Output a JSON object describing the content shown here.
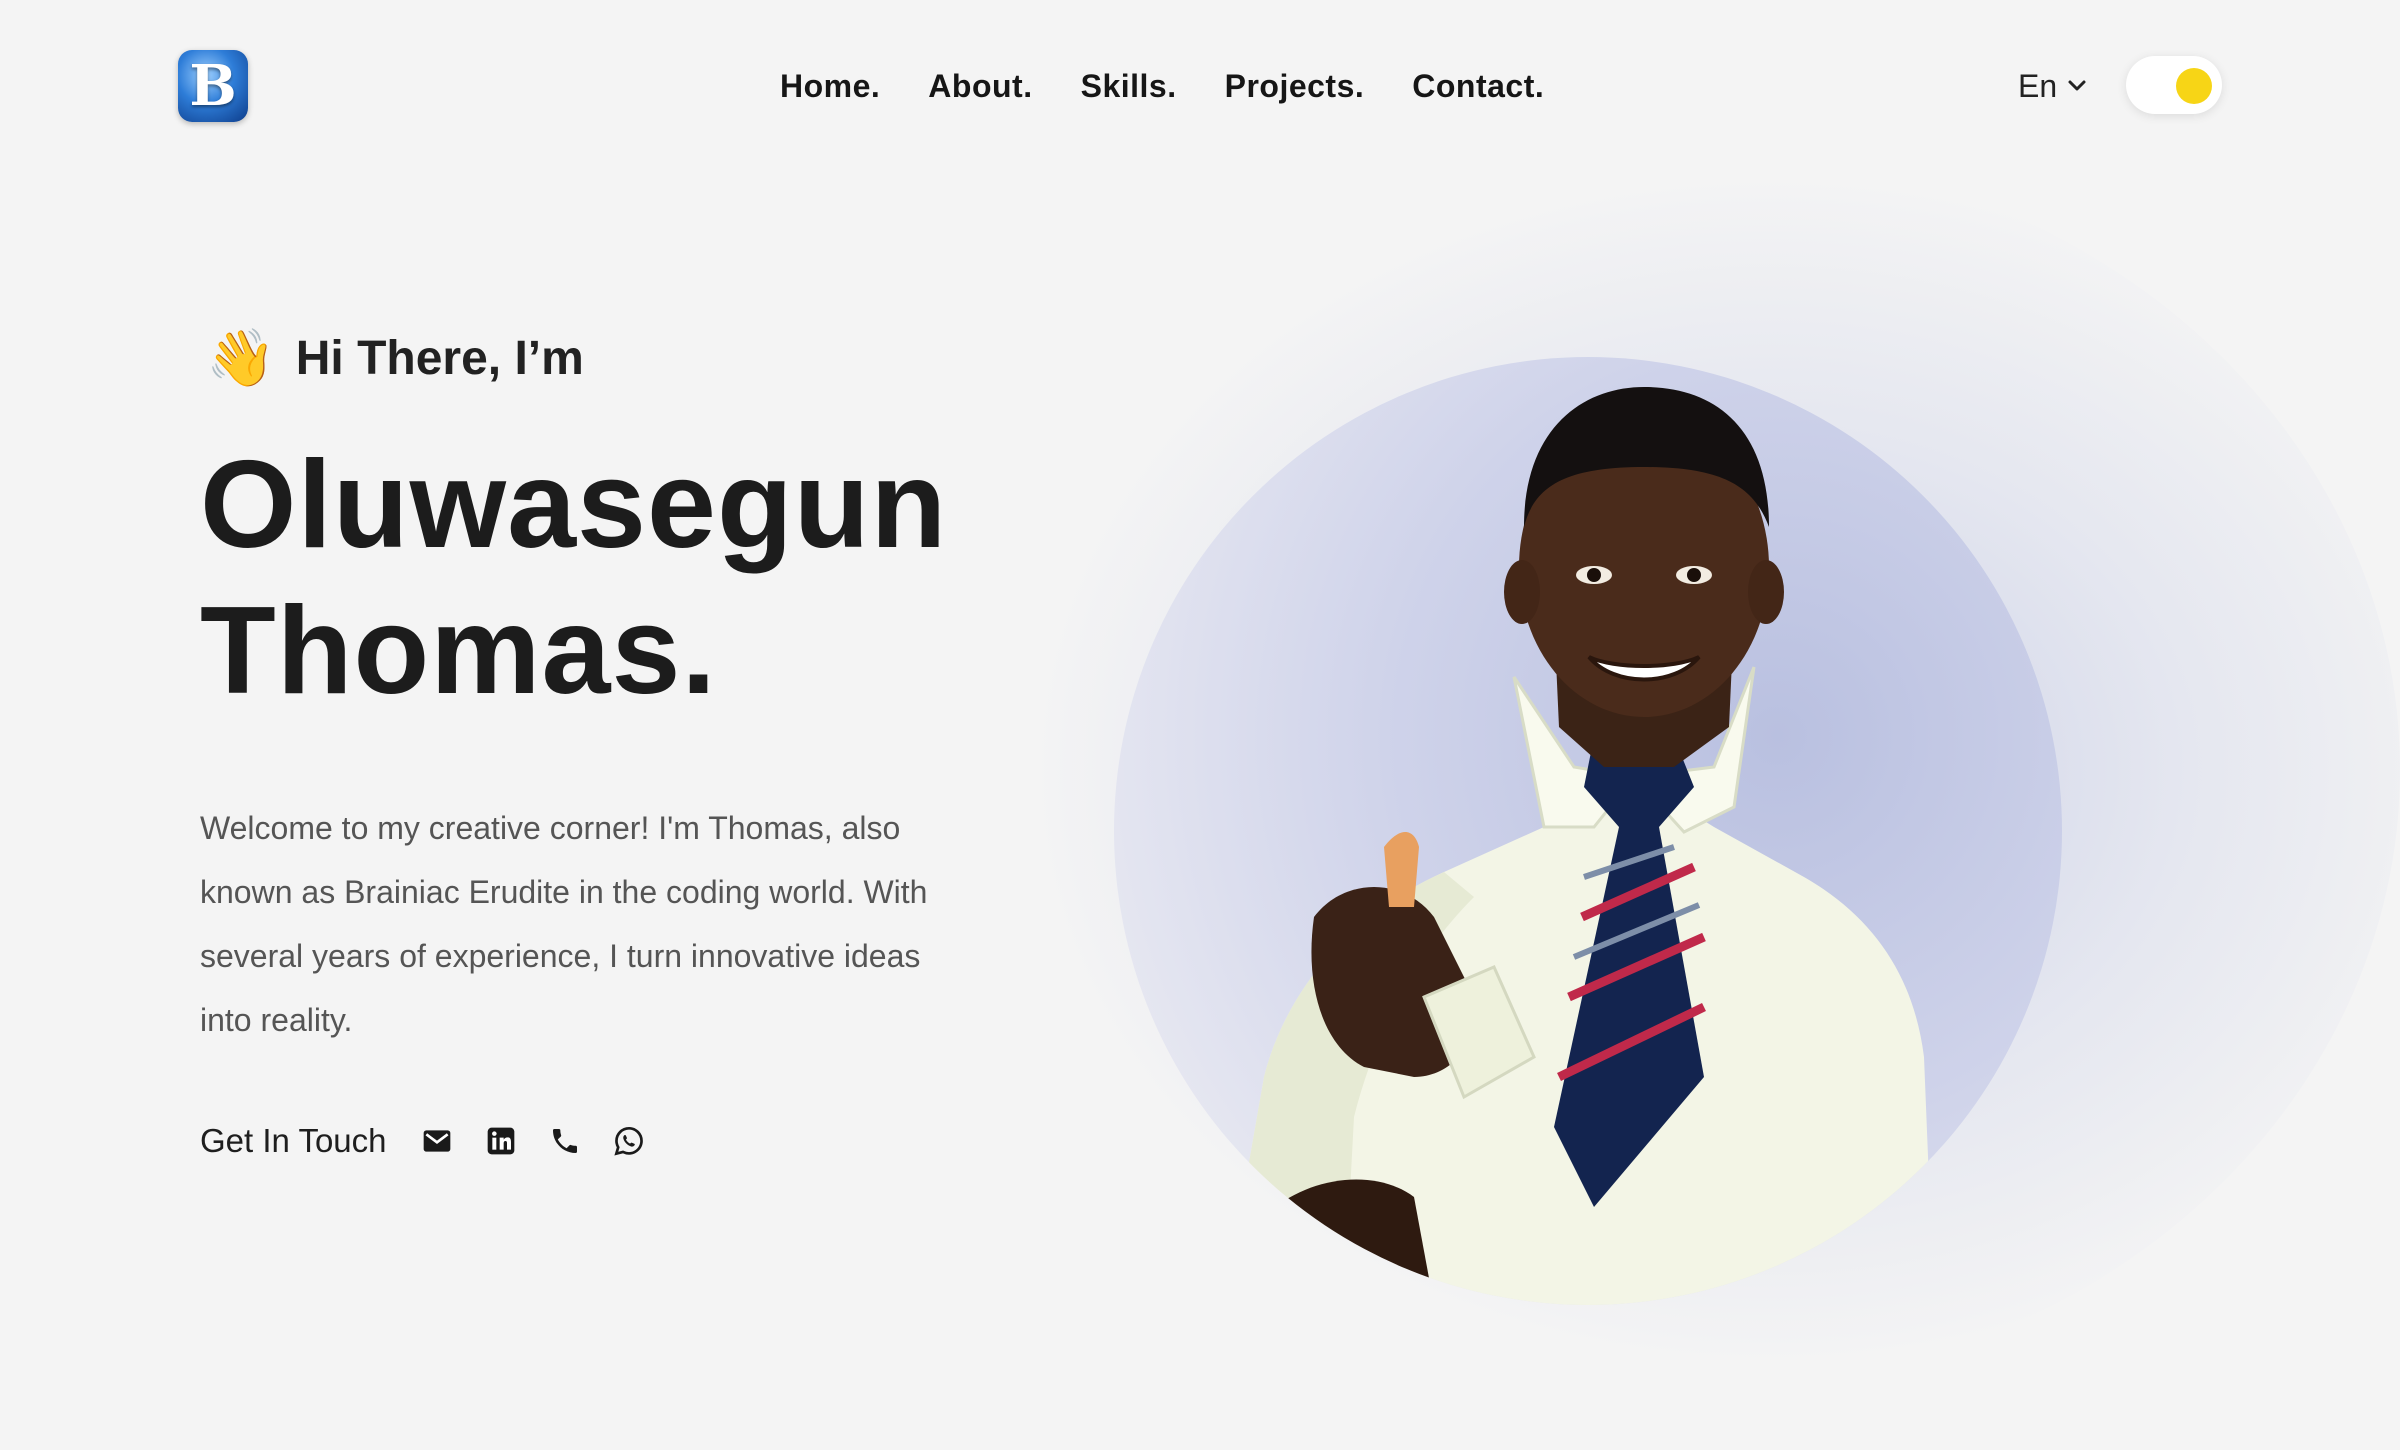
{
  "header": {
    "logo_letter": "B",
    "nav": [
      {
        "label": "Home."
      },
      {
        "label": "About."
      },
      {
        "label": "Skills."
      },
      {
        "label": "Projects."
      },
      {
        "label": "Contact."
      }
    ],
    "language": "En",
    "theme_toggle": {
      "state": "on",
      "knob_color": "#f7d516"
    }
  },
  "hero": {
    "greeting_icon": "waving-hand",
    "greeting": "Hi There, I’m",
    "name_line1": "Oluwasegun",
    "name_line2": "Thomas.",
    "bio": "Welcome to my creative corner! I'm Thomas, also known as Brainiac Erudite in the coding world. With several years of experience, I turn innovative ideas into reality.",
    "contact_label": "Get In Touch",
    "contact_icons": [
      "email-icon",
      "linkedin-icon",
      "phone-icon",
      "whatsapp-icon"
    ]
  },
  "colors": {
    "background": "#f4f4f4",
    "text": "#1f1f1f",
    "body_text": "#555555",
    "accent_yellow": "#f7d516"
  }
}
